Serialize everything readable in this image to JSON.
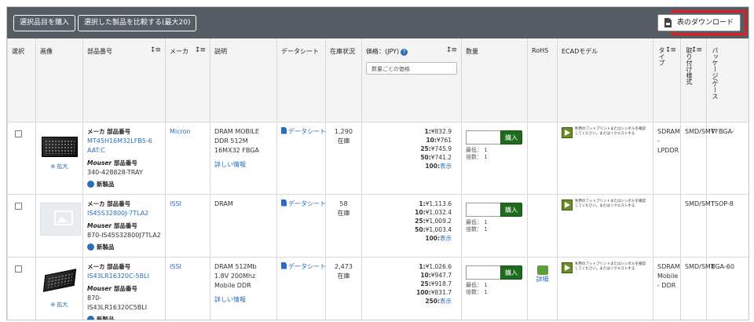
{
  "toolbar": {
    "buy_selected": "選択品目を購入",
    "compare_selected": "選択した製品を比較する(最大20)",
    "download_table": "表のダウンロード"
  },
  "columns": {
    "select": "選択",
    "image": "画像",
    "part_number": "部品番号",
    "manufacturer": "メーカ",
    "description": "説明",
    "datasheet": "データシート",
    "stock": "在庫状況",
    "price": "価格：(JPY)",
    "price_help": "?",
    "price_filter_placeholder": "数量ごとの価格",
    "quantity": "数量",
    "rohs": "RoHS",
    "ecad": "ECADモデル",
    "type": "タイプ",
    "mounting": "取り付け様式",
    "package": "パッケージ/ケース"
  },
  "labels": {
    "mfr_part": "メーカ 部品番号",
    "mouser_part": "Mouser",
    "mouser_part_suffix": " 部品番号",
    "new_product": "新製品",
    "zoom": "拡大",
    "details": "詳しい情報",
    "datasheet": "データシート",
    "buy": "購入",
    "rohs_details": "詳細",
    "ecad_text": "利用のフットプリントまたはシンボルを確認してください。またはリクエストする"
  },
  "rows": [
    {
      "mfr_part_no": "MT45H16M32LFB5-6 AAT:C",
      "mouser_part_no": "340-428828-TRAY",
      "manufacturer": "Micron",
      "description": "DRAM MOBILE DDR 512M 16MX32 FBGA",
      "stock_count": "1,290",
      "stock_label": "在庫",
      "price_breaks": [
        {
          "qty": "1:",
          "price": "¥832.9"
        },
        {
          "qty": "10:",
          "price": "¥761"
        },
        {
          "qty": "25:",
          "price": "¥745.9"
        },
        {
          "qty": "50:",
          "price": "¥741.2"
        },
        {
          "qty": "100:",
          "price": "表示"
        }
      ],
      "min": "最低： 1",
      "mult": "倍数： 1",
      "type": "SDRAM - LPDDR",
      "mounting": "SMD/SMT",
      "package": "VFBGA-"
    },
    {
      "mfr_part_no": "IS45S32800J-7TLA2",
      "mouser_part_no": "870-IS45S32800J7TLA2",
      "manufacturer": "ISSI",
      "description": "DRAM",
      "stock_count": "58",
      "stock_label": "在庫",
      "price_breaks": [
        {
          "qty": "1:",
          "price": "¥1,113.6"
        },
        {
          "qty": "10:",
          "price": "¥1,032.4"
        },
        {
          "qty": "25:",
          "price": "¥1,009.2"
        },
        {
          "qty": "50:",
          "price": "¥1,003.4"
        },
        {
          "qty": "100:",
          "price": "表示"
        }
      ],
      "min": "最低： 1",
      "mult": "倍数： 1",
      "type": "",
      "mounting": "SMD/SMT",
      "package": "TSOP-8"
    },
    {
      "mfr_part_no": "IS43LR16320C-5BLI",
      "mouser_part_no": "870-IS43LR16320C5BLI",
      "manufacturer": "ISSI",
      "description": "DRAM 512Mb 1.8V 200Mhz Mobile DDR",
      "stock_count": "2,473",
      "stock_label": "在庫",
      "price_breaks": [
        {
          "qty": "1:",
          "price": "¥1,026.6"
        },
        {
          "qty": "10:",
          "price": "¥947.7"
        },
        {
          "qty": "25:",
          "price": "¥918.7"
        },
        {
          "qty": "100:",
          "price": "¥831.7"
        },
        {
          "qty": "250:",
          "price": "表示"
        }
      ],
      "min": "最低： 1",
      "mult": "倍数： 1",
      "type": "SDRAM Mobile - DDR",
      "mounting": "SMD/SMT",
      "package": "BGA-60"
    }
  ]
}
